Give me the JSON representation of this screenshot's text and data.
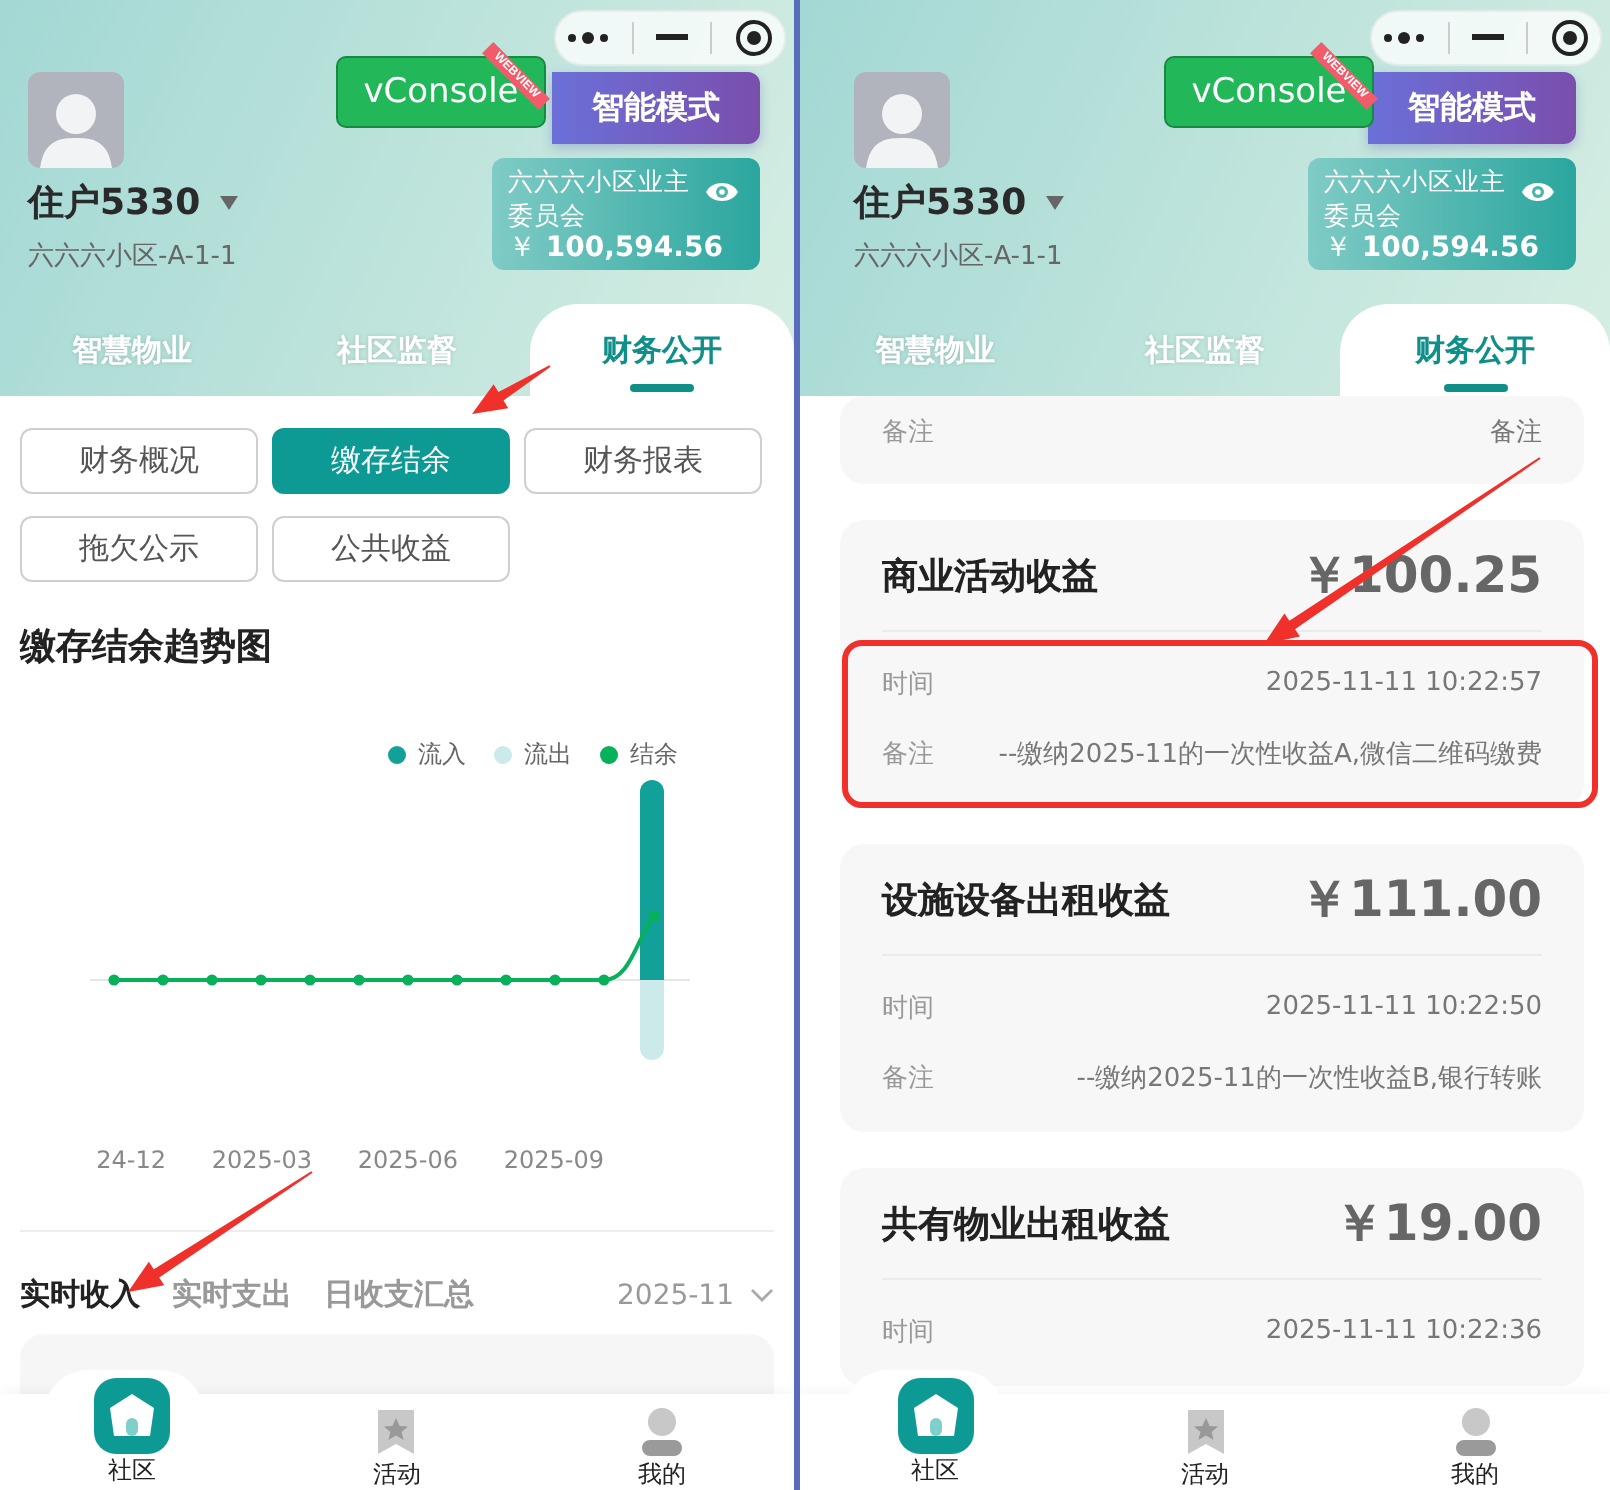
{
  "panels": [
    {
      "kind": "overview",
      "dev_button": {
        "label": "vConsole",
        "ribbon": "WEBVIEW"
      },
      "user": {
        "name": "住户5330",
        "address": "六六六小区-A-1-1"
      },
      "mode_button": "智能模式",
      "fund_card": {
        "name": "六六六小区业主委员会",
        "currency": "￥",
        "balance": "100,594.56"
      },
      "tabs": [
        {
          "label": "智慧物业",
          "selected": false
        },
        {
          "label": "社区监督",
          "selected": false
        },
        {
          "label": "财务公开",
          "selected": true
        }
      ],
      "filter_buttons": [
        {
          "label": "财务概况",
          "selected": false,
          "pointer": false
        },
        {
          "label": "缴存结余",
          "selected": true,
          "pointer": true
        },
        {
          "label": "财务报表",
          "selected": false,
          "pointer": false
        },
        {
          "label": "拖欠公示",
          "selected": false,
          "pointer": false
        },
        {
          "label": "公共收益",
          "selected": false,
          "pointer": false
        }
      ],
      "chart": {
        "title": "缴存结余趋势图",
        "legend": [
          {
            "label": "流入",
            "color": "#12a198"
          },
          {
            "label": "流出",
            "color": "#cdeaea"
          },
          {
            "label": "结余",
            "color": "#07b05a"
          }
        ],
        "x_labels": [
          "24-12",
          "2025-03",
          "2025-06",
          "2025-09"
        ]
      },
      "sub_tabs": [
        {
          "label": "实时收入",
          "selected": true,
          "pointer": true
        },
        {
          "label": "实时支出",
          "selected": false,
          "pointer": false
        },
        {
          "label": "日收支汇总",
          "selected": false,
          "pointer": false
        }
      ],
      "month": "2025-11",
      "nav": [
        {
          "label": "社区",
          "selected": true
        },
        {
          "label": "活动",
          "selected": false
        },
        {
          "label": "我的",
          "selected": false
        }
      ]
    },
    {
      "kind": "records",
      "dev_button": {
        "label": "vConsole",
        "ribbon": "WEBVIEW"
      },
      "user": {
        "name": "住户5330",
        "address": "六六六小区-A-1-1"
      },
      "mode_button": "智能模式",
      "fund_card": {
        "name": "六六六小区业主委员会",
        "currency": "￥",
        "balance": "100,594.56"
      },
      "tabs": [
        {
          "label": "智慧物业",
          "selected": false
        },
        {
          "label": "社区监督",
          "selected": false
        },
        {
          "label": "财务公开",
          "selected": true
        }
      ],
      "records": [
        {
          "highlighted": false,
          "rows": [
            {
              "label": "备注",
              "value": "备注"
            }
          ]
        },
        {
          "title": "商业活动收益",
          "amount": "￥100.25",
          "highlighted": true,
          "rows": [
            {
              "label": "时间",
              "value": "2025-11-11 10:22:57"
            },
            {
              "label": "备注",
              "value": "--缴纳2025-11的一次性收益A,微信二维码缴费"
            }
          ]
        },
        {
          "title": "设施设备出租收益",
          "amount": "￥111.00",
          "highlighted": false,
          "rows": [
            {
              "label": "时间",
              "value": "2025-11-11 10:22:50"
            },
            {
              "label": "备注",
              "value": "--缴纳2025-11的一次性收益B,银行转账"
            }
          ]
        },
        {
          "title": "共有物业出租收益",
          "amount": "￥19.00",
          "highlighted": false,
          "rows": [
            {
              "label": "时间",
              "value": "2025-11-11 10:22:36"
            }
          ]
        }
      ],
      "nav": [
        {
          "label": "社区",
          "selected": true
        },
        {
          "label": "活动",
          "selected": false
        },
        {
          "label": "我的",
          "selected": false
        }
      ]
    }
  ]
}
